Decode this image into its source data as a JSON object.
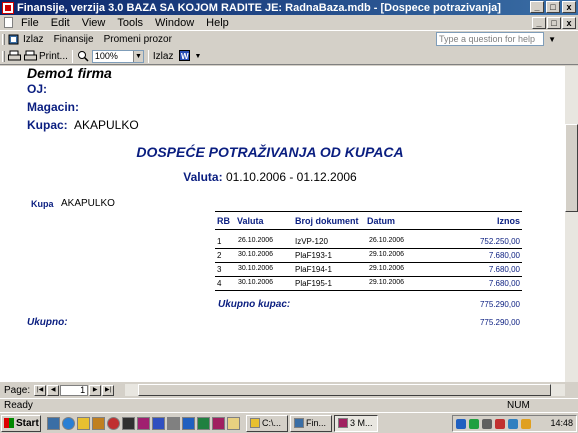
{
  "window": {
    "title": "Finansije, verzija 3.0    BAZA SA KOJOM RADITE JE: RadnaBaza.mdb - [Dospece potrazivanja]",
    "min_label": "_",
    "max_label": "□",
    "close_label": "x"
  },
  "menu": {
    "items": [
      "File",
      "Edit",
      "View",
      "Tools",
      "Window",
      "Help"
    ],
    "help_placeholder": "Type a question for help"
  },
  "toolbar1": {
    "links": [
      "Izlaz",
      "Finansije",
      "Promeni prozor"
    ]
  },
  "toolbar2": {
    "print_label": "Print...",
    "zoom_value": "100%",
    "close_label": "Izlaz"
  },
  "report": {
    "firm": "Demo1 firma",
    "oj_label": "OJ:",
    "magacin_label": "Magacin:",
    "kupac_label": "Kupac:",
    "kupac_value": "AKAPULKO",
    "title": "DOSPEĆE POTRAŽIVANJA OD KUPACA",
    "valuta_label": "Valuta:",
    "valuta_range": "01.10.2006 - 01.12.2006",
    "kupa_label": "Kupa",
    "kupa_value": "AKAPULKO",
    "columns": {
      "rb": "RB",
      "valuta": "Valuta",
      "broj": "Broj dokument",
      "datum": "Datum",
      "iznos": "Iznos"
    },
    "rows": [
      {
        "rb": "1",
        "valuta": "26.10.2006",
        "broj": "IzVP-120",
        "datum": "26.10.2006",
        "iznos": "752.250,00"
      },
      {
        "rb": "2",
        "valuta": "30.10.2006",
        "broj": "PlaF193-1",
        "datum": "29.10.2006",
        "iznos": "7.680,00"
      },
      {
        "rb": "3",
        "valuta": "30.10.2006",
        "broj": "PlaF194-1",
        "datum": "29.10.2006",
        "iznos": "7.680,00"
      },
      {
        "rb": "4",
        "valuta": "30.10.2006",
        "broj": "PlaF195-1",
        "datum": "29.10.2006",
        "iznos": "7.680,00"
      }
    ],
    "total_kupac_label": "Ukupno kupac:",
    "total_kupac_value": "775.290,00",
    "ukupno_label": "Ukupno:",
    "ukupno_value": "775.290,00"
  },
  "pagenav": {
    "label": "Page:",
    "page": "1"
  },
  "status": {
    "text": "Ready",
    "num": "NUM"
  },
  "taskbar": {
    "start": "Start",
    "tasks": [
      "C:\\...",
      "Fin...",
      "3 M..."
    ],
    "clock": "14:48"
  }
}
